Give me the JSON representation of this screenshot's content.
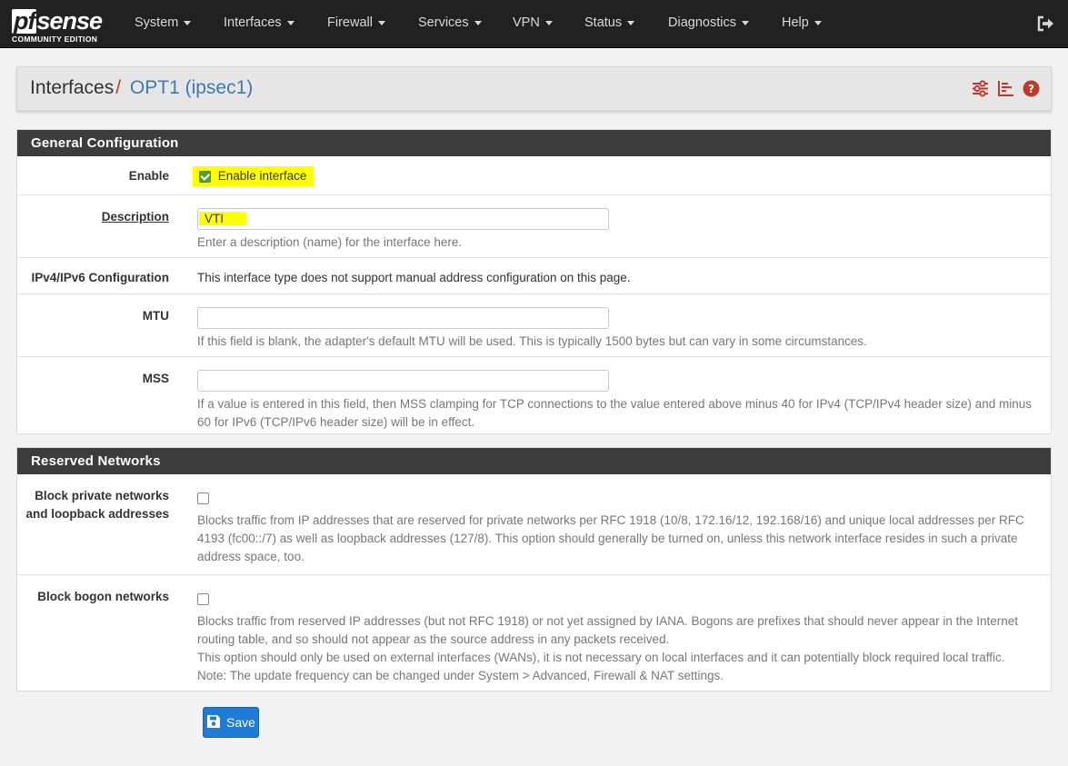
{
  "brand": {
    "name_pf": "pf",
    "name_rest": "sense",
    "edition": "COMMUNITY EDITION"
  },
  "nav": {
    "items": [
      {
        "label": "System"
      },
      {
        "label": "Interfaces"
      },
      {
        "label": "Firewall"
      },
      {
        "label": "Services"
      },
      {
        "label": "VPN"
      },
      {
        "label": "Status"
      },
      {
        "label": "Diagnostics"
      },
      {
        "label": "Help"
      }
    ],
    "logout_icon": "sign-out-icon"
  },
  "breadcrumb": {
    "parent": "Interfaces",
    "separator": "/",
    "current": "OPT1 (ipsec1)",
    "icons": [
      "sliders-icon",
      "list-chart-icon",
      "help-circle-icon"
    ]
  },
  "general": {
    "title": "General Configuration",
    "enable": {
      "label": "Enable",
      "checkbox_label": "Enable interface",
      "checked": true
    },
    "description": {
      "label": "Description",
      "value": "VTI",
      "help": "Enter a description (name) for the interface here."
    },
    "ipconfig": {
      "label": "IPv4/IPv6 Configuration",
      "text": "This interface type does not support manual address configuration on this page."
    },
    "mtu": {
      "label": "MTU",
      "value": "",
      "help": "If this field is blank, the adapter's default MTU will be used. This is typically 1500 bytes but can vary in some circumstances."
    },
    "mss": {
      "label": "MSS",
      "value": "",
      "help": "If a value is entered in this field, then MSS clamping for TCP connections to the value entered above minus 40 for IPv4 (TCP/IPv4 header size) and minus 60 for IPv6 (TCP/IPv6 header size) will be in effect."
    }
  },
  "reserved": {
    "title": "Reserved Networks",
    "private": {
      "label_line1": "Block private networks",
      "label_line2": "and loopback addresses",
      "checked": false,
      "help": "Blocks traffic from IP addresses that are reserved for private networks per RFC 1918 (10/8, 172.16/12, 192.168/16) and unique local addresses per RFC 4193 (fc00::/7) as well as loopback addresses (127/8). This option should generally be turned on, unless this network interface resides in such a private address space, too."
    },
    "bogon": {
      "label": "Block bogon networks",
      "checked": false,
      "help1": "Blocks traffic from reserved IP addresses (but not RFC 1918) or not yet assigned by IANA. Bogons are prefixes that should never appear in the Internet routing table, and so should not appear as the source address in any packets received.",
      "help2": "This option should only be used on external interfaces (WANs), it is not necessary on local interfaces and it can potentially block required local traffic.",
      "help3": "Note: The update frequency can be changed under System > Advanced, Firewall & NAT settings."
    }
  },
  "actions": {
    "save_label": "Save"
  },
  "colors": {
    "navbar": "#212121",
    "panel_header": "#3c3c3c",
    "accent_red": "#c0392b",
    "link_blue": "#3d7ab8",
    "save_blue": "#1e7bd6",
    "highlight": "#ffff00"
  }
}
